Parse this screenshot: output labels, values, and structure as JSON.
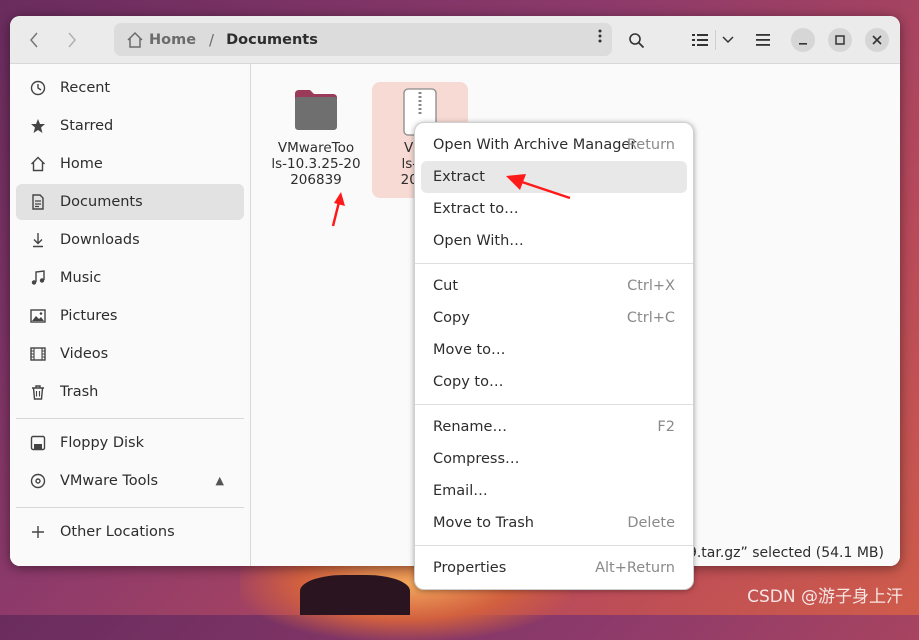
{
  "window": {
    "path": {
      "home": "Home",
      "separator": "/",
      "current": "Documents"
    }
  },
  "sidebar": {
    "items": [
      {
        "label": "Recent",
        "icon": "clock-icon"
      },
      {
        "label": "Starred",
        "icon": "star-icon"
      },
      {
        "label": "Home",
        "icon": "home-icon"
      },
      {
        "label": "Documents",
        "icon": "document-icon",
        "active": true
      },
      {
        "label": "Downloads",
        "icon": "download-icon"
      },
      {
        "label": "Music",
        "icon": "music-icon"
      },
      {
        "label": "Pictures",
        "icon": "pictures-icon"
      },
      {
        "label": "Videos",
        "icon": "video-icon"
      },
      {
        "label": "Trash",
        "icon": "trash-icon"
      }
    ],
    "devices": [
      {
        "label": "Floppy Disk",
        "icon": "floppy-icon"
      },
      {
        "label": "VMware Tools",
        "icon": "disc-icon"
      }
    ],
    "other": {
      "label": "Other Locations",
      "icon": "plus-icon"
    }
  },
  "files": [
    {
      "label": "VMwareTools-10.3.25-20206839",
      "label_lines": [
        "VMwareToo",
        "ls-10.3.25-20",
        "206839"
      ],
      "type": "folder"
    },
    {
      "label": "VMwareTools-10.3.25-20206839.tar.gz",
      "label_lines": [
        "VMw",
        "ls-10.",
        "2068."
      ],
      "type": "archive",
      "selected": true
    }
  ],
  "status_text": "39.tar.gz” selected  (54.1 MB)",
  "context_menu": {
    "groups": [
      [
        {
          "label": "Open With Archive Manager",
          "accel": "Return"
        },
        {
          "label": "Extract",
          "accel": "",
          "highlighted": true
        },
        {
          "label": "Extract to…",
          "accel": ""
        },
        {
          "label": "Open With…",
          "accel": ""
        }
      ],
      [
        {
          "label": "Cut",
          "accel": "Ctrl+X"
        },
        {
          "label": "Copy",
          "accel": "Ctrl+C"
        },
        {
          "label": "Move to…",
          "accel": ""
        },
        {
          "label": "Copy to…",
          "accel": ""
        }
      ],
      [
        {
          "label": "Rename…",
          "accel": "F2"
        },
        {
          "label": "Compress…",
          "accel": ""
        },
        {
          "label": "Email…",
          "accel": ""
        },
        {
          "label": "Move to Trash",
          "accel": "Delete"
        }
      ],
      [
        {
          "label": "Properties",
          "accel": "Alt+Return"
        }
      ]
    ]
  },
  "watermark": "CSDN @游子身上汗",
  "colors": {
    "accent": "#e95420",
    "annotation_red": "#ff0000",
    "selected_bg": "#f8dad4"
  }
}
